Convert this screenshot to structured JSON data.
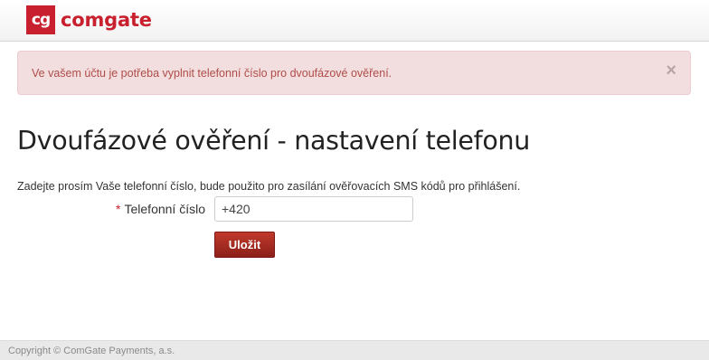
{
  "header": {
    "logo_mark": "cg",
    "logo_text": "comgate"
  },
  "alert": {
    "message": "Ve vašem účtu je potřeba vyplnit telefonní číslo pro dvoufázové ověření.",
    "close_symbol": "×"
  },
  "main": {
    "title": "Dvoufázové ověření - nastavení telefonu",
    "intro": "Zadejte prosím Vaše telefonní číslo, bude použito pro zasílání ověřovacích SMS kódů pro přihlášení.",
    "phone_field": {
      "required_marker": "*",
      "label": "Telefonní číslo",
      "value": "+420"
    },
    "save_label": "Uložit"
  },
  "footer": {
    "copyright": "Copyright © ComGate Payments, a.s."
  },
  "colors": {
    "brand": "#c8202e",
    "alert_bg": "#f2dede",
    "alert_text": "#b04d4a",
    "button_bg": "#a82b24",
    "footer_bg": "#e9e9e9"
  },
  "icons": {
    "logo": "comgate-logo-icon",
    "alert_close": "close-icon"
  }
}
